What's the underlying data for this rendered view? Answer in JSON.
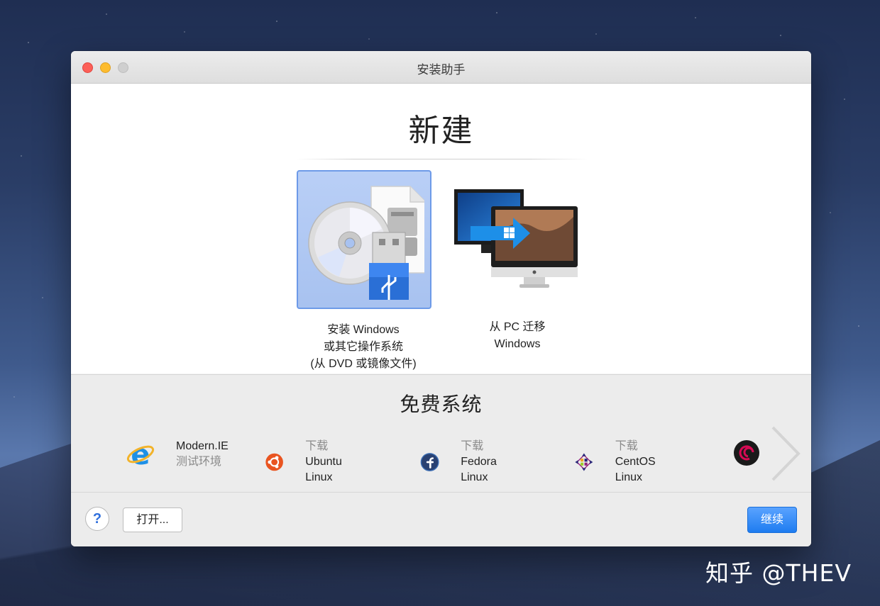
{
  "window": {
    "title": "安装助手"
  },
  "new_section": {
    "title": "新建",
    "options": [
      {
        "label_lines": [
          "安装 Windows",
          "或其它操作系统",
          "(从 DVD 或镜像文件)"
        ],
        "selected": true
      },
      {
        "label_lines": [
          "从 PC 迁移",
          "Windows"
        ],
        "selected": false
      }
    ]
  },
  "free_section": {
    "title": "免费系统",
    "items": [
      {
        "icon": "internet-explorer-icon",
        "main": "Modern.IE",
        "sub": "测试环境"
      },
      {
        "icon": "ubuntu-icon",
        "sub": "下载",
        "main": "Ubuntu Linux"
      },
      {
        "icon": "fedora-icon",
        "sub": "下载",
        "main": "Fedora Linux"
      },
      {
        "icon": "centos-icon",
        "sub": "下载",
        "main": "CentOS Linux"
      },
      {
        "icon": "debian-icon",
        "sub": "",
        "main": ""
      }
    ]
  },
  "footer": {
    "help_label": "?",
    "open_label": "打开...",
    "continue_label": "继续"
  },
  "watermark": "知乎 @THEV",
  "colors": {
    "accent": "#2f80f0",
    "selection": "#a8c2f0"
  }
}
